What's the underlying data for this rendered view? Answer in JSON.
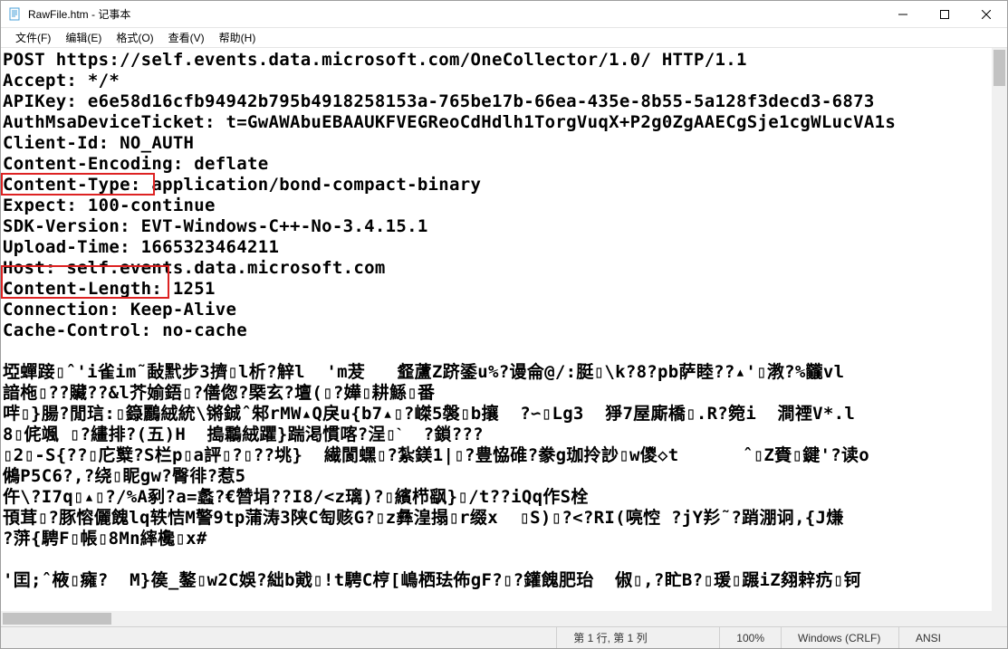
{
  "window": {
    "title": "RawFile.htm - 记事本"
  },
  "menu": {
    "file": "文件(F)",
    "edit": "编辑(E)",
    "format": "格式(O)",
    "view": "查看(V)",
    "help": "帮助(H)"
  },
  "content": {
    "lines": [
      "POST https://self.events.data.microsoft.com/OneCollector/1.0/ HTTP/1.1",
      "Accept: */*",
      "APIKey: e6e58d16cfb94942b795b4918258153a-765be17b-66ea-435e-8b55-5a128f3decd3-6873",
      "AuthMsaDeviceTicket: t=GwAWAbuEBAAUKFVEGReoCdHdlh1TorgVuqX+P2g0ZgAAECgSje1cgWLucVA1s",
      "Client-Id: NO_AUTH",
      "Content-Encoding: deflate",
      "Content-Type: application/bond-compact-binary",
      "Expect: 100-continue",
      "SDK-Version: EVT-Windows-C++-No-3.4.15.1",
      "Upload-Time: 1665323464211",
      "Host: self.events.data.microsoft.com",
      "Content-Length: 1251",
      "Connection: Keep-Alive",
      "Cache-Control: no-cache",
      "",
      "埡蟬踥▯ˆ'i雀im˜敮黓步3擠▯l析?觪l  'm茇   韰蘆Z跻鋈u%?谩侖@/:脡▯\\k?8?pb萨睦??▴'▯漖?%龖vl",
      "諳柂▯??贜??&l芥媮鋙▯?僐偬?槩玄?壇(▯?嬅▯耕鯀▯番",
      "哶▯}腸?閒琂:▯籙鸝絨統\\锵鋮ˆ邾rMW▴Q戾u{b7▴▯?嵥5褩▯b攘  ?∽▯Lg3  猙7屋廝橋▯.R?箢i  澗禋V*.l",
      "8▯侂颯 ▯?繣排?(五)H  搗鸘絨躣}踹渇慣喀?浧▯ˋ  ?鎖???",
      "▯2▯-S{??▯庀糱?S栏p▯a評▯?▯??垗}  繊閬蟔▯?紮鎂1|▯?豊恊碓?豢g珈拎訬▯w儍◇t      ˆ▯Z賚▯鍵'?读o",
      "鵂P5C6?,?绕▯眤gw?臀徘?惹5",
      "仵\\?I7q▯▴▯?/%A剢?a=蠡?€㬱埍??I8/<z璃)?▯繽栉飖}▯/t??iQq作S栓",
      "頇茸▯?豚愹儷餽lq轶恄M警9tp蒲涛3陕C匋赅G?▯z彝湟搨▯r缀x  ▯S)▯?<?RI(喨悾 ?jY羏˜?踃淜诇,{J熑",
      "?蓱{騁F▯帳▯8Mn繂欃▯x#",
      "",
      "'囯;ˆ棭▯癕?  M}篌_鏊▯w2C娛?絀b戭▯!t騁C梈[嶋栖珐佈gF?▯?鑵餽肥珆  俶▯,?盳B?▯瑗▯蹍іZ翗辢疓▯钶"
    ]
  },
  "status": {
    "position": "第 1 行, 第 1 列",
    "zoom": "100%",
    "lineending": "Windows (CRLF)",
    "encoding": "ANSI"
  }
}
